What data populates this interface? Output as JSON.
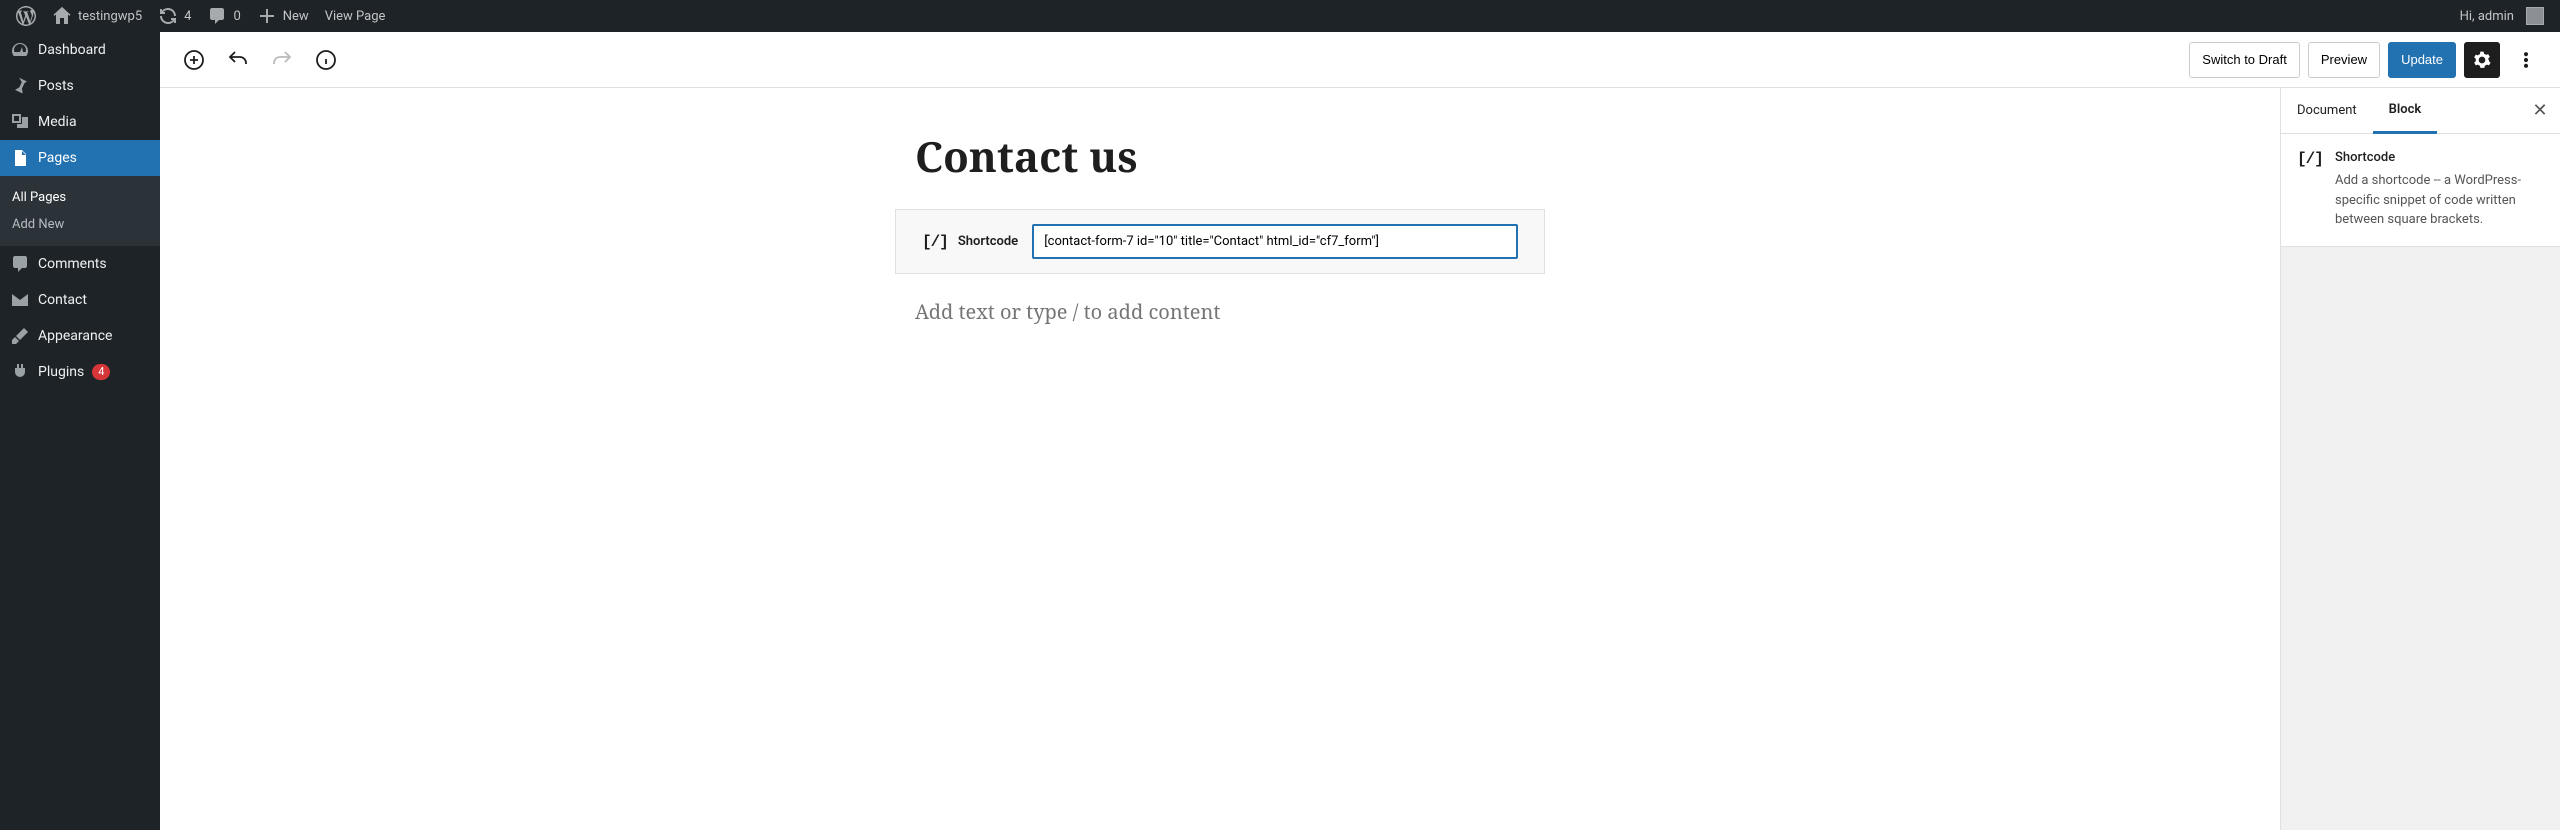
{
  "adminbar": {
    "site_name": "testingwp5",
    "updates_count": "4",
    "comments_count": "0",
    "new_label": "New",
    "view_page_label": "View Page",
    "greeting": "Hi, admin"
  },
  "sidebar": {
    "items": [
      {
        "label": "Dashboard",
        "icon": "dashboard"
      },
      {
        "label": "Posts",
        "icon": "pin"
      },
      {
        "label": "Media",
        "icon": "media"
      },
      {
        "label": "Pages",
        "icon": "pages",
        "current": true
      },
      {
        "label": "Comments",
        "icon": "comment"
      },
      {
        "label": "Contact",
        "icon": "mail"
      },
      {
        "label": "Appearance",
        "icon": "brush"
      },
      {
        "label": "Plugins",
        "icon": "plug",
        "badge": "4"
      }
    ],
    "submenu": {
      "all_pages": "All Pages",
      "add_new": "Add New"
    }
  },
  "toolbar": {
    "switch_to_draft": "Switch to Draft",
    "preview": "Preview",
    "update": "Update"
  },
  "page": {
    "title": "Contact us",
    "shortcode_label": "Shortcode",
    "shortcode_value": "[contact-form-7 id=\"10\" title=\"Contact\" html_id=\"cf7_form\"]",
    "paragraph_placeholder": "Add text or type / to add content"
  },
  "inspector": {
    "tab_document": "Document",
    "tab_block": "Block",
    "block_title": "Shortcode",
    "block_desc": "Add a shortcode -- a WordPress-specific snippet of code written between square brackets."
  }
}
